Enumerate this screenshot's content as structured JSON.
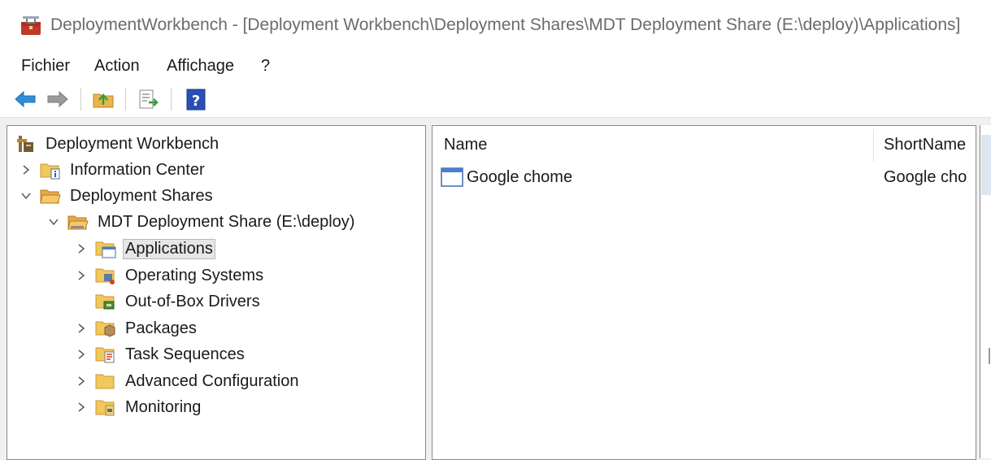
{
  "window": {
    "title": "DeploymentWorkbench - [Deployment Workbench\\Deployment Shares\\MDT Deployment Share (E:\\deploy)\\Applications]"
  },
  "menu": {
    "items": [
      "Fichier",
      "Action",
      "Affichage",
      "?"
    ]
  },
  "toolbar": {
    "buttons": [
      "back-arrow-icon",
      "forward-arrow-icon",
      "up-folder-icon",
      "export-list-icon",
      "help-icon"
    ]
  },
  "tree": {
    "nodes": [
      {
        "label": "Deployment Workbench",
        "icon": "workbench-icon",
        "expander": "none",
        "depth": 0
      },
      {
        "label": "Information Center",
        "icon": "info-folder-icon",
        "expander": "collapsed",
        "depth": 1
      },
      {
        "label": "Deployment Shares",
        "icon": "shares-folder-icon",
        "expander": "expanded",
        "depth": 1
      },
      {
        "label": "MDT Deployment Share (E:\\deploy)",
        "icon": "share-folder-icon",
        "expander": "expanded",
        "depth": 2
      },
      {
        "label": "Applications",
        "icon": "applications-folder-icon",
        "expander": "collapsed",
        "depth": 3,
        "selected": true
      },
      {
        "label": "Operating Systems",
        "icon": "os-folder-icon",
        "expander": "collapsed",
        "depth": 3
      },
      {
        "label": "Out-of-Box Drivers",
        "icon": "drivers-folder-icon",
        "expander": "none",
        "depth": 3
      },
      {
        "label": "Packages",
        "icon": "packages-folder-icon",
        "expander": "collapsed",
        "depth": 3
      },
      {
        "label": "Task Sequences",
        "icon": "task-sequences-folder-icon",
        "expander": "collapsed",
        "depth": 3
      },
      {
        "label": "Advanced Configuration",
        "icon": "folder-icon",
        "expander": "collapsed",
        "depth": 3
      },
      {
        "label": "Monitoring",
        "icon": "monitoring-folder-icon",
        "expander": "collapsed",
        "depth": 3
      }
    ]
  },
  "list": {
    "columns": [
      "Name",
      "ShortName"
    ],
    "rows": [
      {
        "name": "Google chome",
        "short_name": "Google cho",
        "icon": "application-window-icon"
      }
    ]
  },
  "colors": {
    "selection": "#e6e6e6",
    "border": "#8a8a8a",
    "folder": "#f2c75c"
  }
}
